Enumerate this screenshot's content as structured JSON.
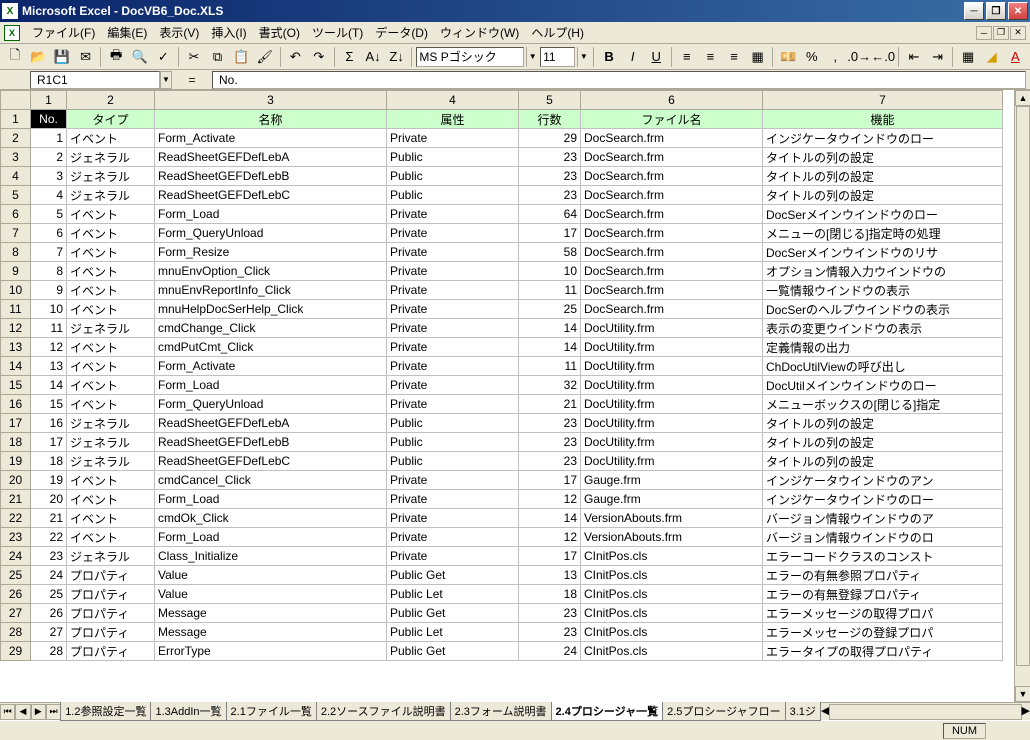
{
  "titlebar": {
    "title": "Microsoft Excel - DocVB6_Doc.XLS"
  },
  "menu": {
    "items": [
      "ファイル(F)",
      "編集(E)",
      "表示(V)",
      "挿入(I)",
      "書式(O)",
      "ツール(T)",
      "データ(D)",
      "ウィンドウ(W)",
      "ヘルプ(H)"
    ]
  },
  "toolbar": {
    "font": "MS Pゴシック",
    "size": "11"
  },
  "formula": {
    "name_box": "R1C1",
    "value": "No."
  },
  "column_letters": [
    "1",
    "2",
    "3",
    "4",
    "5",
    "6",
    "7"
  ],
  "headers": [
    "No.",
    "タイプ",
    "名称",
    "属性",
    "行数",
    "ファイル名",
    "機能"
  ],
  "rows": [
    {
      "n": 1,
      "type": "イベント",
      "name": "Form_Activate",
      "attr": "Private",
      "lines": 29,
      "file": "DocSearch.frm",
      "func": "インジケータウインドウのロー"
    },
    {
      "n": 2,
      "type": "ジェネラル",
      "name": "ReadSheetGEFDefLebA",
      "attr": "Public",
      "lines": 23,
      "file": "DocSearch.frm",
      "func": "タイトルの列の設定"
    },
    {
      "n": 3,
      "type": "ジェネラル",
      "name": "ReadSheetGEFDefLebB",
      "attr": "Public",
      "lines": 23,
      "file": "DocSearch.frm",
      "func": "タイトルの列の設定"
    },
    {
      "n": 4,
      "type": "ジェネラル",
      "name": "ReadSheetGEFDefLebC",
      "attr": "Public",
      "lines": 23,
      "file": "DocSearch.frm",
      "func": "タイトルの列の設定"
    },
    {
      "n": 5,
      "type": "イベント",
      "name": "Form_Load",
      "attr": "Private",
      "lines": 64,
      "file": "DocSearch.frm",
      "func": "DocSerメインウインドウのロー"
    },
    {
      "n": 6,
      "type": "イベント",
      "name": "Form_QueryUnload",
      "attr": "Private",
      "lines": 17,
      "file": "DocSearch.frm",
      "func": "メニューの[閉じる]指定時の処理"
    },
    {
      "n": 7,
      "type": "イベント",
      "name": "Form_Resize",
      "attr": "Private",
      "lines": 58,
      "file": "DocSearch.frm",
      "func": "DocSerメインウインドウのリサ"
    },
    {
      "n": 8,
      "type": "イベント",
      "name": "mnuEnvOption_Click",
      "attr": "Private",
      "lines": 10,
      "file": "DocSearch.frm",
      "func": "オプション情報入力ウインドウの"
    },
    {
      "n": 9,
      "type": "イベント",
      "name": "mnuEnvReportInfo_Click",
      "attr": "Private",
      "lines": 11,
      "file": "DocSearch.frm",
      "func": "一覧情報ウインドウの表示"
    },
    {
      "n": 10,
      "type": "イベント",
      "name": "mnuHelpDocSerHelp_Click",
      "attr": "Private",
      "lines": 25,
      "file": "DocSearch.frm",
      "func": "DocSerのヘルプウインドウの表示"
    },
    {
      "n": 11,
      "type": "ジェネラル",
      "name": "cmdChange_Click",
      "attr": "Private",
      "lines": 14,
      "file": "DocUtility.frm",
      "func": "表示の変更ウインドウの表示"
    },
    {
      "n": 12,
      "type": "イベント",
      "name": "cmdPutCmt_Click",
      "attr": "Private",
      "lines": 14,
      "file": "DocUtility.frm",
      "func": "定義情報の出力"
    },
    {
      "n": 13,
      "type": "イベント",
      "name": "Form_Activate",
      "attr": "Private",
      "lines": 11,
      "file": "DocUtility.frm",
      "func": "ChDocUtilViewの呼び出し"
    },
    {
      "n": 14,
      "type": "イベント",
      "name": "Form_Load",
      "attr": "Private",
      "lines": 32,
      "file": "DocUtility.frm",
      "func": "DocUtilメインウインドウのロー"
    },
    {
      "n": 15,
      "type": "イベント",
      "name": "Form_QueryUnload",
      "attr": "Private",
      "lines": 21,
      "file": "DocUtility.frm",
      "func": "メニューボックスの[閉じる]指定"
    },
    {
      "n": 16,
      "type": "ジェネラル",
      "name": "ReadSheetGEFDefLebA",
      "attr": "Public",
      "lines": 23,
      "file": "DocUtility.frm",
      "func": "タイトルの列の設定"
    },
    {
      "n": 17,
      "type": "ジェネラル",
      "name": "ReadSheetGEFDefLebB",
      "attr": "Public",
      "lines": 23,
      "file": "DocUtility.frm",
      "func": "タイトルの列の設定"
    },
    {
      "n": 18,
      "type": "ジェネラル",
      "name": "ReadSheetGEFDefLebC",
      "attr": "Public",
      "lines": 23,
      "file": "DocUtility.frm",
      "func": "タイトルの列の設定"
    },
    {
      "n": 19,
      "type": "イベント",
      "name": "cmdCancel_Click",
      "attr": "Private",
      "lines": 17,
      "file": "Gauge.frm",
      "func": "インジケータウインドウのアン"
    },
    {
      "n": 20,
      "type": "イベント",
      "name": "Form_Load",
      "attr": "Private",
      "lines": 12,
      "file": "Gauge.frm",
      "func": "インジケータウインドウのロー"
    },
    {
      "n": 21,
      "type": "イベント",
      "name": "cmdOk_Click",
      "attr": "Private",
      "lines": 14,
      "file": "VersionAbouts.frm",
      "func": "バージョン情報ウインドウのア"
    },
    {
      "n": 22,
      "type": "イベント",
      "name": "Form_Load",
      "attr": "Private",
      "lines": 12,
      "file": "VersionAbouts.frm",
      "func": "バージョン情報ウインドウのロ"
    },
    {
      "n": 23,
      "type": "ジェネラル",
      "name": "Class_Initialize",
      "attr": "Private",
      "lines": 17,
      "file": "CInitPos.cls",
      "func": "エラーコードクラスのコンスト"
    },
    {
      "n": 24,
      "type": "プロパティ",
      "name": "Value",
      "attr": "Public Get",
      "lines": 13,
      "file": "CInitPos.cls",
      "func": "エラーの有無参照プロパティ"
    },
    {
      "n": 25,
      "type": "プロパティ",
      "name": "Value",
      "attr": "Public Let",
      "lines": 18,
      "file": "CInitPos.cls",
      "func": "エラーの有無登録プロパティ"
    },
    {
      "n": 26,
      "type": "プロパティ",
      "name": "Message",
      "attr": "Public Get",
      "lines": 23,
      "file": "CInitPos.cls",
      "func": "エラーメッセージの取得プロパ"
    },
    {
      "n": 27,
      "type": "プロパティ",
      "name": "Message",
      "attr": "Public Let",
      "lines": 23,
      "file": "CInitPos.cls",
      "func": "エラーメッセージの登録プロパ"
    },
    {
      "n": 28,
      "type": "プロパティ",
      "name": "ErrorType",
      "attr": "Public Get",
      "lines": 24,
      "file": "CInitPos.cls",
      "func": "エラータイプの取得プロパティ"
    }
  ],
  "tabs": [
    "1.2参照設定一覧",
    "1.3AddIn一覧",
    "2.1ファイル一覧",
    "2.2ソースファイル説明書",
    "2.3フォーム説明書",
    "2.4プロシージャ一覧",
    "2.5プロシージャフロー",
    "3.1ジ"
  ],
  "active_tab": 5,
  "status": {
    "num": "NUM"
  }
}
